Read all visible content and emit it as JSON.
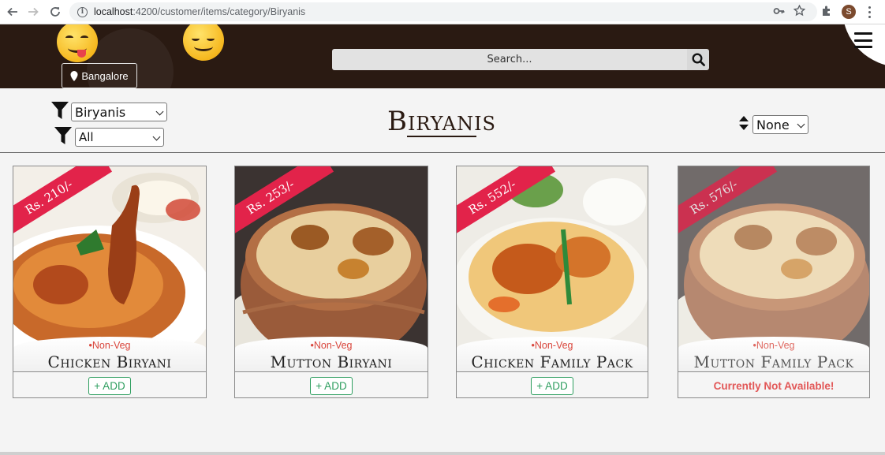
{
  "browser": {
    "url_host": "localhost",
    "url_path": ":4200/customer/items/category/Biryanis",
    "profile_initial": "S"
  },
  "header": {
    "location_label": "Bangalore",
    "search_placeholder": "Search..."
  },
  "filters": {
    "category_value": "Biryanis",
    "type_value": "All",
    "sort_value": "None"
  },
  "page_title": "Biryanis",
  "items": [
    {
      "price": "Rs. 210/-",
      "tag": "•Non-Veg",
      "name": "Chicken Biryani",
      "action": "+ ADD",
      "available": true
    },
    {
      "price": "Rs. 253/-",
      "tag": "•Non-Veg",
      "name": "Mutton Biryani",
      "action": "+ ADD",
      "available": true
    },
    {
      "price": "Rs. 552/-",
      "tag": "•Non-Veg",
      "name": "Chicken Family Pack",
      "action": "+ ADD",
      "available": true
    },
    {
      "price": "Rs. 576/-",
      "tag": "•Non-Veg",
      "name": "Mutton Family Pack",
      "action": "Currently Not Available!",
      "available": false
    }
  ],
  "colors": {
    "header_bg": "#2a1a12",
    "ribbon": "#e2234a",
    "add_green": "#2e9e5f",
    "non_veg_red": "#d9453b",
    "unavailable_red": "#e25757"
  }
}
